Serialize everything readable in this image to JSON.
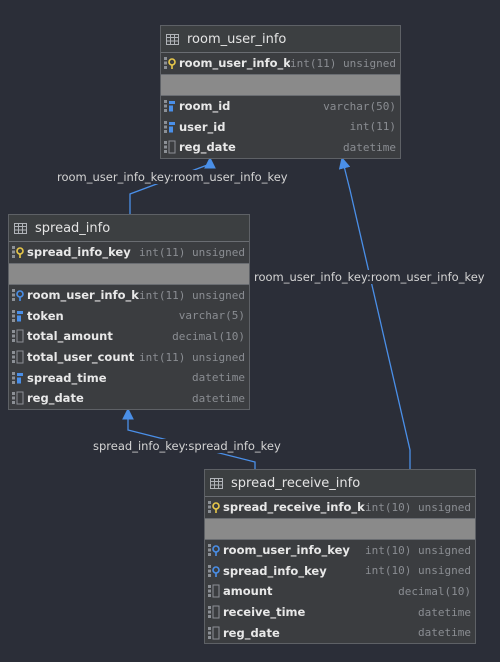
{
  "tables": [
    {
      "name": "room_user_info",
      "pk": {
        "name": "room_user_info_key",
        "type": "int(11) unsigned",
        "icon": "primary-key-icon"
      },
      "columns": [
        {
          "name": "room_id",
          "type": "varchar(50)",
          "icon": "index-column-icon"
        },
        {
          "name": "user_id",
          "type": "int(11)",
          "icon": "index-column-icon"
        },
        {
          "name": "reg_date",
          "type": "datetime",
          "icon": "column-icon"
        }
      ]
    },
    {
      "name": "spread_info",
      "pk": {
        "name": "spread_info_key",
        "type": "int(11) unsigned",
        "icon": "primary-key-icon"
      },
      "columns": [
        {
          "name": "room_user_info_key",
          "type": "int(11) unsigned",
          "icon": "foreign-key-icon"
        },
        {
          "name": "token",
          "type": "varchar(5)",
          "icon": "index-column-icon"
        },
        {
          "name": "total_amount",
          "type": "decimal(10)",
          "icon": "column-icon"
        },
        {
          "name": "total_user_count",
          "type": "int(11) unsigned",
          "icon": "column-icon"
        },
        {
          "name": "spread_time",
          "type": "datetime",
          "icon": "index-column-icon"
        },
        {
          "name": "reg_date",
          "type": "datetime",
          "icon": "column-icon"
        }
      ]
    },
    {
      "name": "spread_receive_info",
      "pk": {
        "name": "spread_receive_info_key",
        "type": "int(10) unsigned",
        "icon": "primary-key-icon"
      },
      "columns": [
        {
          "name": "room_user_info_key",
          "type": "int(10) unsigned",
          "icon": "foreign-key-icon"
        },
        {
          "name": "spread_info_key",
          "type": "int(10) unsigned",
          "icon": "foreign-key-icon"
        },
        {
          "name": "amount",
          "type": "decimal(10)",
          "icon": "column-icon"
        },
        {
          "name": "receive_time",
          "type": "datetime",
          "icon": "column-icon"
        },
        {
          "name": "reg_date",
          "type": "datetime",
          "icon": "column-icon"
        }
      ]
    }
  ],
  "relations": [
    {
      "label": "room_user_info_key:room_user_info_key",
      "from": "spread_info",
      "to": "room_user_info"
    },
    {
      "label": "room_user_info_key:room_user_info_key",
      "from": "spread_receive_info",
      "to": "room_user_info"
    },
    {
      "label": "spread_info_key:spread_info_key",
      "from": "spread_receive_info",
      "to": "spread_info"
    }
  ],
  "colors": {
    "background": "#2b2e38",
    "connector": "#4a8fe8",
    "key_gold": "#e8c84a",
    "key_blue": "#4a8fe8"
  }
}
